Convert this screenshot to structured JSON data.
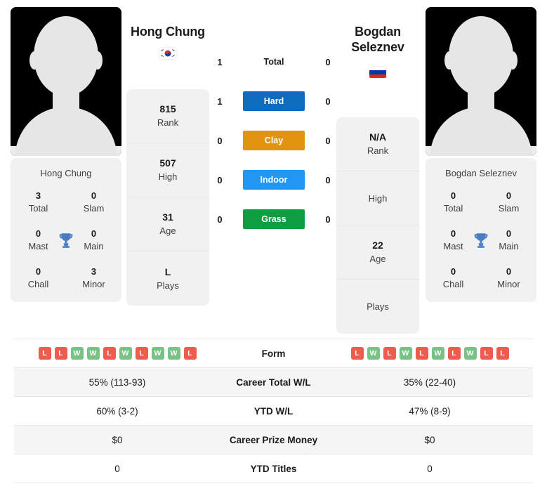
{
  "players": {
    "left": {
      "name": "Hong Chung",
      "flag": "south-korea-flag",
      "avatar": "player-silhouette-avatar",
      "rank": "815",
      "rank_label": "Rank",
      "high": "507",
      "high_label": "High",
      "age": "31",
      "age_label": "Age",
      "plays": "L",
      "plays_label": "Plays",
      "titles": {
        "total": "3",
        "total_label": "Total",
        "slam": "0",
        "slam_label": "Slam",
        "mast": "0",
        "mast_label": "Mast",
        "main": "0",
        "main_label": "Main",
        "chall": "0",
        "chall_label": "Chall",
        "minor": "3",
        "minor_label": "Minor"
      }
    },
    "right": {
      "name": "Bogdan Seleznev",
      "flag": "russia-flag",
      "avatar": "player-silhouette-avatar",
      "rank": "N/A",
      "rank_label": "Rank",
      "high": "",
      "high_label": "High",
      "age": "22",
      "age_label": "Age",
      "plays": "",
      "plays_label": "Plays",
      "titles": {
        "total": "0",
        "total_label": "Total",
        "slam": "0",
        "slam_label": "Slam",
        "mast": "0",
        "mast_label": "Mast",
        "main": "0",
        "main_label": "Main",
        "chall": "0",
        "chall_label": "Chall",
        "minor": "0",
        "minor_label": "Minor"
      }
    }
  },
  "head_to_head": [
    {
      "label": "Total",
      "left": "1",
      "right": "0",
      "color": "transparent"
    },
    {
      "label": "Hard",
      "left": "1",
      "right": "0",
      "color": "#0d6cbd"
    },
    {
      "label": "Clay",
      "left": "0",
      "right": "0",
      "color": "#e09410"
    },
    {
      "label": "Indoor",
      "left": "0",
      "right": "0",
      "color": "#2196f3"
    },
    {
      "label": "Grass",
      "left": "0",
      "right": "0",
      "color": "#0f9d42"
    }
  ],
  "stats_rows": [
    {
      "label": "Form",
      "type": "form",
      "left_form": [
        "L",
        "L",
        "W",
        "W",
        "L",
        "W",
        "L",
        "W",
        "W",
        "L"
      ],
      "right_form": [
        "L",
        "W",
        "L",
        "W",
        "L",
        "W",
        "L",
        "W",
        "L",
        "L"
      ]
    },
    {
      "label": "Career Total W/L",
      "type": "text",
      "left": "55% (113-93)",
      "right": "35% (22-40)"
    },
    {
      "label": "YTD W/L",
      "type": "text",
      "left": "60% (3-2)",
      "right": "47% (8-9)"
    },
    {
      "label": "Career Prize Money",
      "type": "text",
      "left": "$0",
      "right": "$0"
    },
    {
      "label": "YTD Titles",
      "type": "text",
      "left": "0",
      "right": "0"
    }
  ],
  "colors": {
    "win_badge": "#77c284",
    "loss_badge": "#ef5b4c",
    "card_bg": "#f1f1f1",
    "row_alt": "#f5f5f5",
    "trophy": "#4a7cc0"
  }
}
